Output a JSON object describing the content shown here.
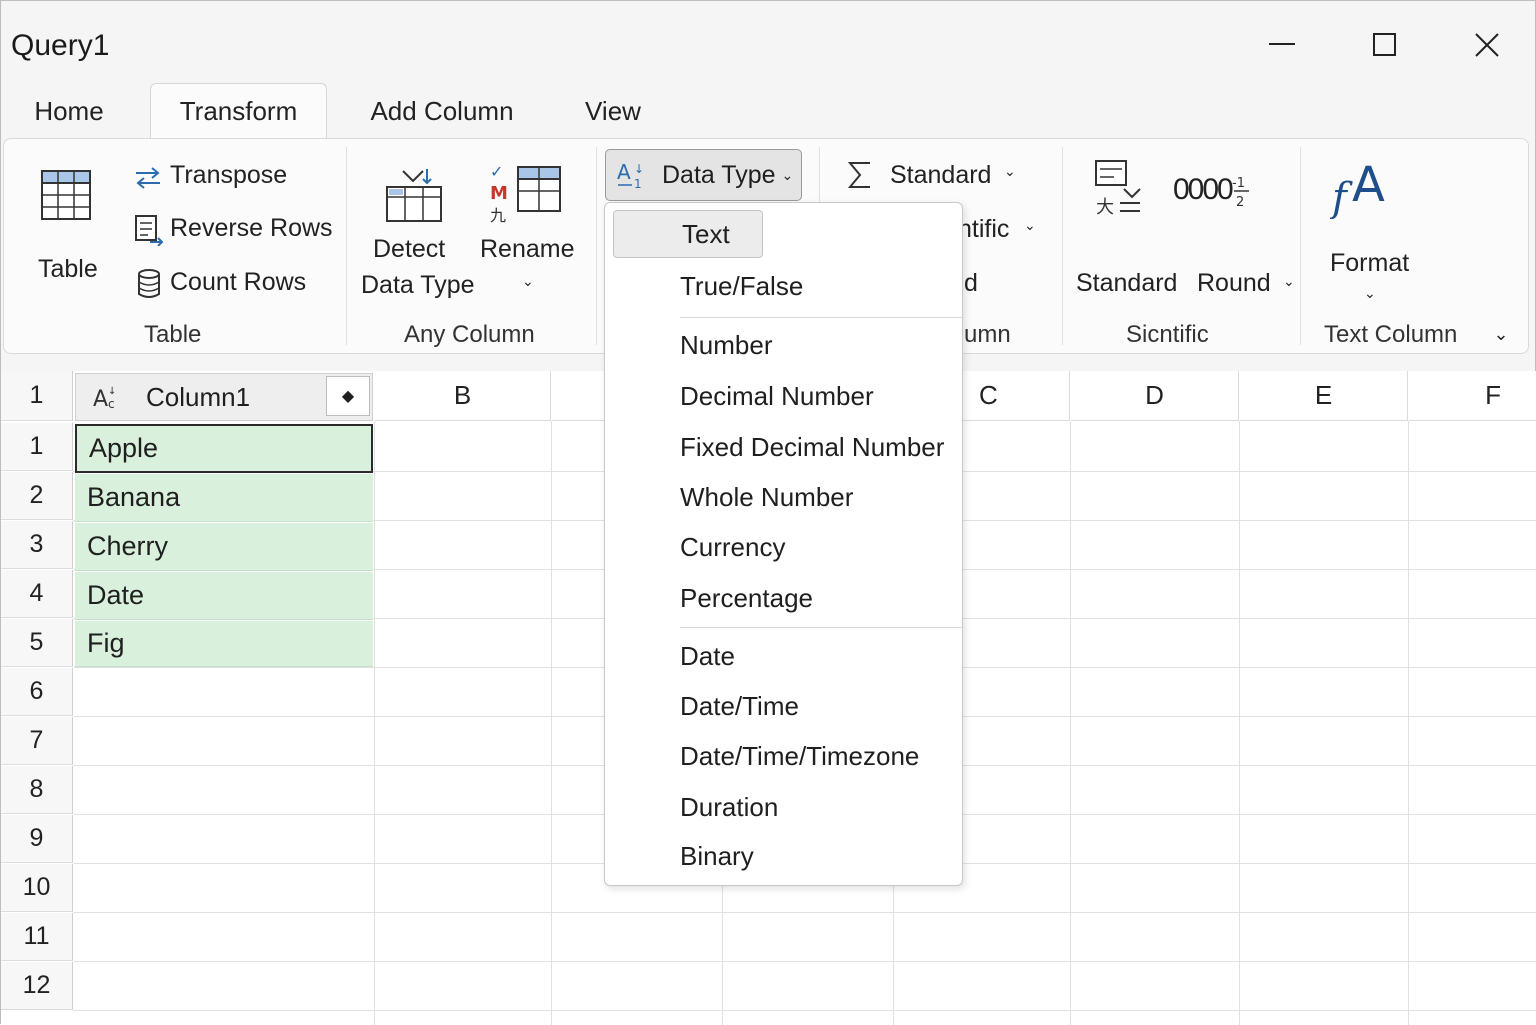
{
  "window": {
    "title": "Query1"
  },
  "tabs": [
    {
      "label": "Home"
    },
    {
      "label": "Transform"
    },
    {
      "label": "Add Column"
    },
    {
      "label": "View"
    }
  ],
  "ribbon": {
    "table_group": {
      "table_label": "Table",
      "transpose": "Transpose",
      "reverse_rows": "Reverse Rows",
      "count_rows": "Count Rows",
      "group_label": "Table"
    },
    "any_column_group": {
      "detect_line1": "Detect",
      "detect_line2": "Data Type",
      "rename": "Rename",
      "group_label": "Any Column"
    },
    "data_type_button": "Data Type",
    "number_group": {
      "standard_dropdown": "Standard",
      "scientific_partial": "ntific",
      "partial_d": "d",
      "group_label_partial": "umn"
    },
    "standard_round_group": {
      "digits": "0000",
      "standard": "Standard",
      "round": "Round",
      "group_label": "Sicntific"
    },
    "format_group": {
      "format": "Format",
      "group_label": "Text Column"
    }
  },
  "dropdown": {
    "items": [
      "Text",
      "True/False",
      "Number",
      "Decimal Number",
      "Fixed Decimal Number",
      "Whole Number",
      "Currency",
      "Percentage",
      "Date",
      "Date/Time",
      "Date/Time/Timezone",
      "Duration",
      "Binary"
    ]
  },
  "grid": {
    "header_row_number": "1",
    "column1_header": "Column1",
    "column_headers": [
      "B",
      "C",
      "D",
      "E",
      "F"
    ],
    "row_numbers": [
      "1",
      "2",
      "3",
      "4",
      "5",
      "6",
      "7",
      "8",
      "9",
      "10",
      "11",
      "12"
    ],
    "column1_values": [
      "Apple",
      "Banana",
      "Cherry",
      "Date",
      "Fig"
    ]
  },
  "colors": {
    "selection_fill": "#d9f0dc",
    "ribbon_bg": "#fbfbfb",
    "accent_red": "#c0392b",
    "accent_blue": "#2b6cb0"
  }
}
